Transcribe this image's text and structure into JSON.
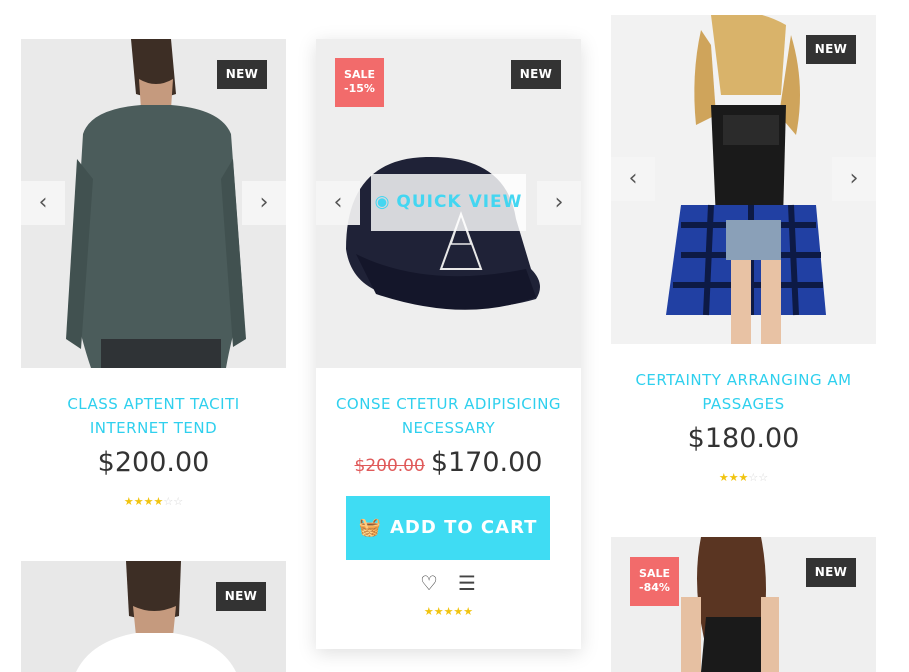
{
  "labels": {
    "new": "NEW",
    "sale": "SALE",
    "quick_view": "QUICK VIEW",
    "add_to_cart": "ADD TO CART"
  },
  "icons": {
    "prev": "‹",
    "next": "›",
    "eye": "eye-icon",
    "bag": "basket-icon",
    "heart": "heart-icon",
    "compare": "compare-icon"
  },
  "products": [
    {
      "title": "CLASS APTENT TACITI INTERNET TEND",
      "price": "$200.00",
      "rating": 3.5,
      "badge": "NEW"
    },
    {
      "title": "CONSE CTETUR ADIPISICING NECESSARY",
      "old_price": "$200.00",
      "price": "$170.00",
      "rating": 5,
      "badge": "NEW",
      "sale": "-15%"
    },
    {
      "title": "CERTAINTY ARRANGING AM PASSAGES",
      "price": "$180.00",
      "rating": 3,
      "badge": "NEW"
    },
    {
      "badge": "NEW"
    },
    {
      "badge": "NEW",
      "sale": "-84%"
    }
  ],
  "colors": {
    "accent": "#3fdcf3",
    "title": "#2fd0ee",
    "badge_new": "#333333",
    "badge_sale": "#f26b6b",
    "old_price": "#e05a5a",
    "star": "#f1c40f"
  }
}
